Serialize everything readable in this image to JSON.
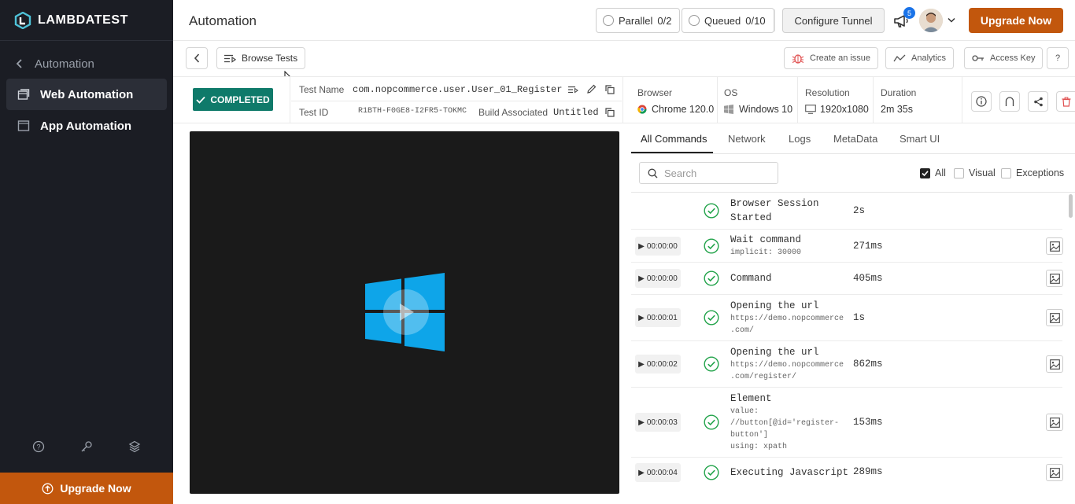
{
  "sidebar": {
    "logo_text": "LAMBDATEST",
    "back_label": "Automation",
    "items": [
      {
        "label": "Web Automation",
        "active": true
      },
      {
        "label": "App Automation",
        "active": false
      }
    ],
    "upgrade_label": "Upgrade Now"
  },
  "header": {
    "title": "Automation",
    "parallel_label": "Parallel",
    "parallel_value": "0/2",
    "queued_label": "Queued",
    "queued_value": "0/10",
    "configure_tunnel": "Configure Tunnel",
    "notification_count": "5",
    "upgrade_label": "Upgrade Now"
  },
  "toolbar": {
    "browse_tests": "Browse Tests",
    "create_issue": "Create an issue",
    "analytics": "Analytics",
    "access_key": "Access Key",
    "help": "?"
  },
  "test": {
    "status": "COMPLETED",
    "name_label": "Test Name",
    "name_value": "com.nopcommerce.user.User_01_Register",
    "id_label": "Test ID",
    "id_value": "R1BTH-F0GE8-I2FR5-TOKMC",
    "build_label": "Build Associated",
    "build_value": "Untitled",
    "browser_label": "Browser",
    "browser_value": "Chrome 120.0",
    "os_label": "OS",
    "os_value": "Windows 10",
    "resolution_label": "Resolution",
    "resolution_value": "1920x1080",
    "duration_label": "Duration",
    "duration_value": "2m 35s"
  },
  "commands_panel": {
    "tabs": [
      "All Commands",
      "Network",
      "Logs",
      "MetaData",
      "Smart UI"
    ],
    "active_tab": "All Commands",
    "search_placeholder": "Search",
    "filters": [
      {
        "label": "All",
        "checked": true
      },
      {
        "label": "Visual",
        "checked": false
      },
      {
        "label": "Exceptions",
        "checked": false
      }
    ],
    "commands": [
      {
        "time": "",
        "name_lines": [
          "Browser Session",
          "Started"
        ],
        "sub_lines": [],
        "duration": "2s"
      },
      {
        "time": "00:00:00",
        "name_lines": [
          "Wait command"
        ],
        "sub_lines": [
          "implicit: 30000"
        ],
        "duration": "271ms"
      },
      {
        "time": "00:00:00",
        "name_lines": [
          "Command"
        ],
        "sub_lines": [],
        "duration": "405ms"
      },
      {
        "time": "00:00:01",
        "name_lines": [
          "Opening the url"
        ],
        "sub_lines": [
          "https://demo.nopcommerce",
          ".com/"
        ],
        "duration": "1s"
      },
      {
        "time": "00:00:02",
        "name_lines": [
          "Opening the url"
        ],
        "sub_lines": [
          "https://demo.nopcommerce",
          ".com/register/"
        ],
        "duration": "862ms"
      },
      {
        "time": "00:00:03",
        "name_lines": [
          "Element"
        ],
        "sub_lines": [
          "value:",
          "//button[@id='register-",
          "button']",
          "using: xpath"
        ],
        "duration": "153ms"
      },
      {
        "time": "00:00:04",
        "name_lines": [
          "Executing Javascript"
        ],
        "sub_lines": [],
        "duration": "289ms"
      }
    ]
  }
}
